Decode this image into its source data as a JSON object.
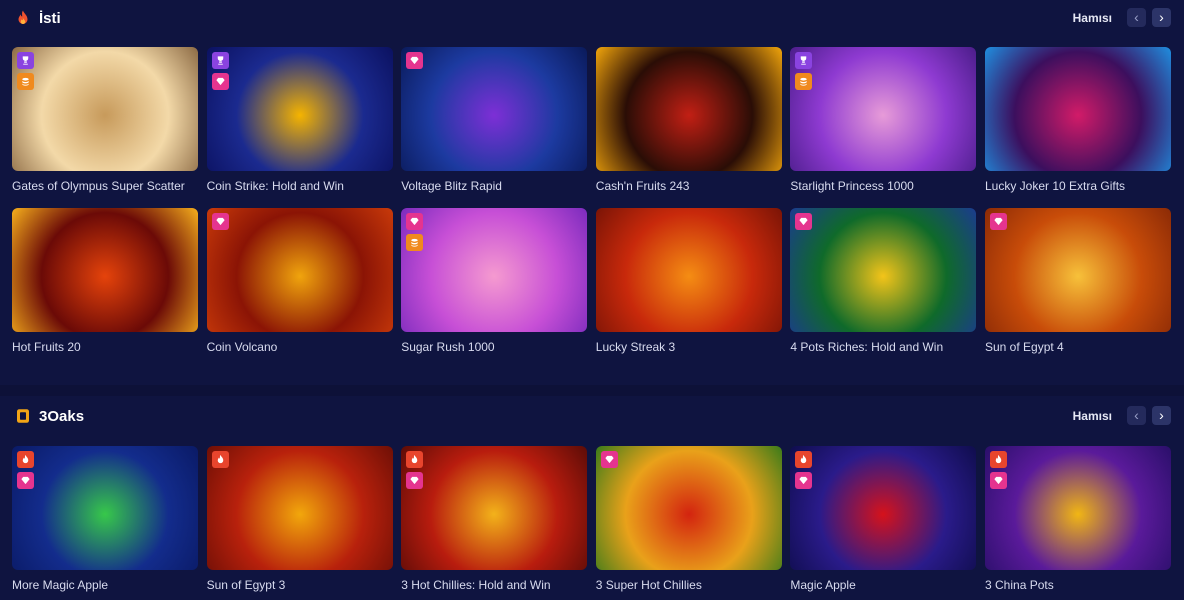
{
  "sections": [
    {
      "id": "hot",
      "title": "İsti",
      "icon": "flame-icon",
      "see_all": "Hamısı",
      "games": [
        {
          "name": "Gates of Olympus Super Scatter",
          "badges": [
            "trophy",
            "coins"
          ],
          "art": [
            "#f3d9a8",
            "#c79a5b",
            "#8c6a44"
          ]
        },
        {
          "name": "Coin Strike: Hold and Win",
          "badges": [
            "trophy",
            "diamond"
          ],
          "art": [
            "#1b2a8f",
            "#f5b400",
            "#0b1160"
          ]
        },
        {
          "name": "Voltage Blitz Rapid",
          "badges": [
            "diamond"
          ],
          "art": [
            "#1c3aa0",
            "#7d2fd6",
            "#0a1a5a"
          ]
        },
        {
          "name": "Cash'n Fruits 243",
          "badges": [],
          "art": [
            "#2a0d06",
            "#c21f14",
            "#f2a60c"
          ]
        },
        {
          "name": "Starlight Princess 1000",
          "badges": [
            "trophy",
            "coins"
          ],
          "art": [
            "#8e3ad1",
            "#e79bd8",
            "#4b1d8a"
          ]
        },
        {
          "name": "Lucky Joker 10 Extra Gifts",
          "badges": [],
          "art": [
            "#3c0f5e",
            "#d21b68",
            "#1f8fe0"
          ]
        }
      ]
    },
    {
      "id": "hot-row2",
      "games": [
        {
          "name": "Hot Fruits 20",
          "badges": [],
          "art": [
            "#6b0a07",
            "#e5430b",
            "#f6b01d"
          ]
        },
        {
          "name": "Coin Volcano",
          "badges": [
            "diamond"
          ],
          "art": [
            "#8b1405",
            "#f0a40d",
            "#c93a0a"
          ]
        },
        {
          "name": "Sugar Rush 1000",
          "badges": [
            "diamond",
            "coins"
          ],
          "art": [
            "#c74fd6",
            "#f59ad0",
            "#7b2bbd"
          ]
        },
        {
          "name": "Lucky Streak 3",
          "badges": [],
          "art": [
            "#c8290b",
            "#f58d13",
            "#7a1406"
          ]
        },
        {
          "name": "4 Pots Riches: Hold and Win",
          "badges": [
            "diamond"
          ],
          "art": [
            "#0f6a2a",
            "#f3c419",
            "#1b3b8f"
          ]
        },
        {
          "name": "Sun of Egypt 4",
          "badges": [
            "diamond"
          ],
          "art": [
            "#c84c09",
            "#f7c13a",
            "#8b2a06"
          ]
        }
      ]
    },
    {
      "id": "3oaks",
      "title": "3Oaks",
      "icon": "3oaks-logo-icon",
      "see_all": "Hamısı",
      "games": [
        {
          "name": "More Magic Apple",
          "badges": [
            "flame",
            "diamond"
          ],
          "art": [
            "#132c8c",
            "#37c84a",
            "#0a1a66"
          ]
        },
        {
          "name": "Sun of Egypt 3",
          "badges": [
            "flame"
          ],
          "art": [
            "#b8210c",
            "#f2a70c",
            "#6e0f06"
          ]
        },
        {
          "name": "3 Hot Chillies: Hold and Win",
          "badges": [
            "flame",
            "diamond"
          ],
          "art": [
            "#b81c0e",
            "#f3b21a",
            "#5c0c07"
          ]
        },
        {
          "name": "3 Super Hot Chillies",
          "badges": [
            "diamond"
          ],
          "art": [
            "#e9a11a",
            "#d3240f",
            "#3a7b1a"
          ]
        },
        {
          "name": "Magic Apple",
          "badges": [
            "flame",
            "diamond"
          ],
          "art": [
            "#2a1b8a",
            "#d5121b",
            "#0f0d4d"
          ]
        },
        {
          "name": "3 China Pots",
          "badges": [
            "flame",
            "diamond"
          ],
          "art": [
            "#5a1a9a",
            "#f1b614",
            "#2a0f6a"
          ]
        }
      ]
    }
  ],
  "colors": {
    "trophy": "#8a43e0",
    "coins": "#f08a1e",
    "diamond": "#e5348f",
    "flame": "#e8452d"
  }
}
